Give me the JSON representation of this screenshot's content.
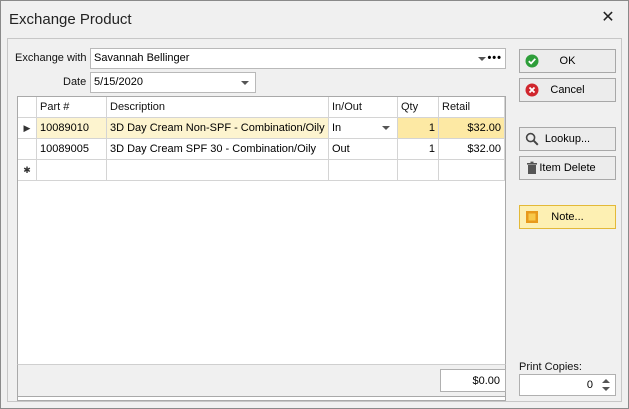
{
  "window": {
    "title": "Exchange Product"
  },
  "form": {
    "exchange_label": "Exchange with",
    "exchange_value": "Savannah Bellinger",
    "ellipsis": "•••",
    "date_label": "Date",
    "date_value": "5/15/2020"
  },
  "grid": {
    "columns": [
      "Part #",
      "Description",
      "In/Out",
      "Qty",
      "Retail"
    ],
    "rows": [
      {
        "indicator": "▶",
        "part": "10089010",
        "description": "3D Day Cream Non-SPF - Combination/Oily",
        "inout": "In",
        "qty": "1",
        "retail": "$32.00"
      },
      {
        "indicator": "",
        "part": "10089005",
        "description": "3D Day Cream SPF 30 - Combination/Oily",
        "inout": "Out",
        "qty": "1",
        "retail": "$32.00"
      }
    ],
    "new_row_indicator": "✱",
    "total": "$0.00"
  },
  "buttons": {
    "ok": "OK",
    "cancel": "Cancel",
    "lookup": "Lookup...",
    "item_delete": "Item Delete",
    "note": "Note..."
  },
  "print": {
    "label": "Print Copies:",
    "value": "0"
  },
  "icons": {
    "ok": "check-circle-icon",
    "cancel": "x-circle-icon",
    "lookup": "magnifier-icon",
    "delete": "trash-icon",
    "note": "note-icon"
  },
  "colors": {
    "ok_green": "#2e9e3a",
    "cancel_red": "#d0262d",
    "note_bg": "#fdf0b3",
    "selected_row": "#fdf4cf"
  }
}
